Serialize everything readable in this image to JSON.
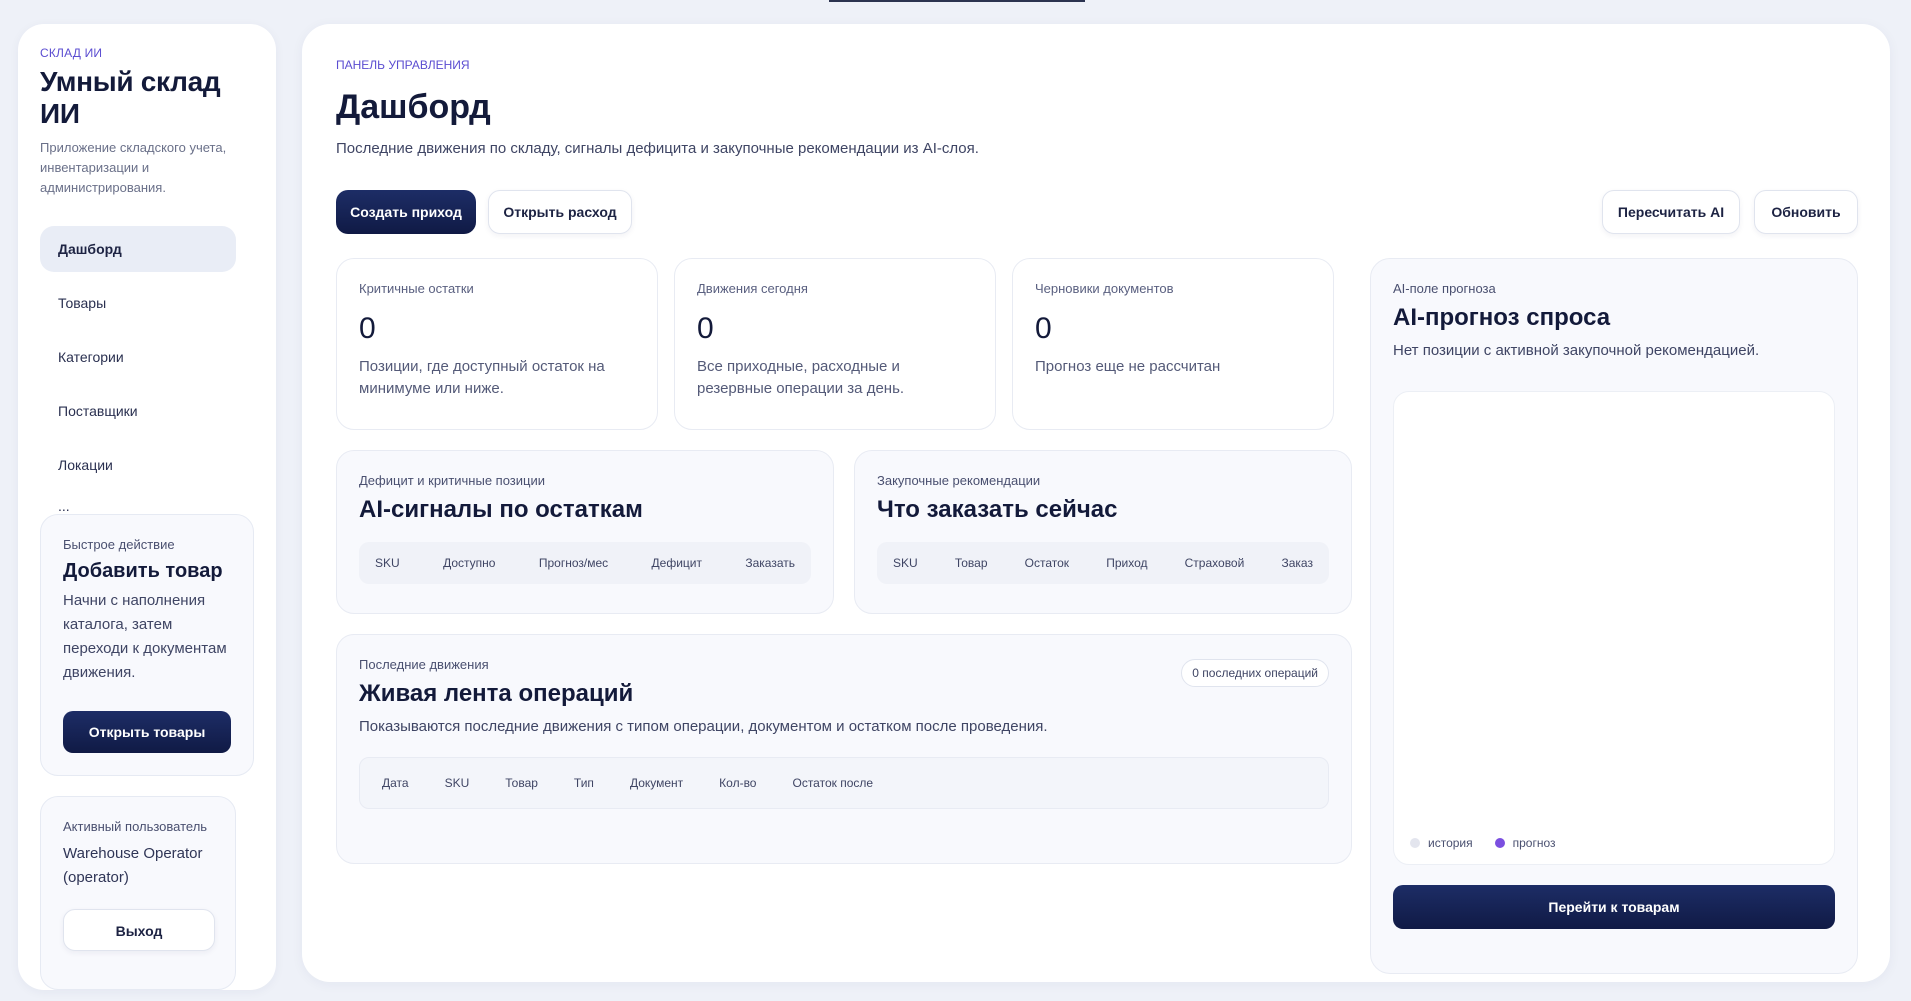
{
  "sidebar": {
    "eyebrow": "СКЛАД ИИ",
    "title": "Умный склад ИИ",
    "description": "Приложение складского учета, инвентаризации и администрирования.",
    "nav": [
      {
        "label": "Дашборд"
      },
      {
        "label": "Товары"
      },
      {
        "label": "Категории"
      },
      {
        "label": "Поставщики"
      },
      {
        "label": "Локации"
      },
      {
        "label": "..."
      }
    ],
    "quick_action": {
      "label": "Быстрое действие",
      "title": "Добавить товар",
      "text": "Начни с наполнения каталога, затем переходи к документам движения.",
      "button": "Открыть товары"
    },
    "user": {
      "label": "Активный пользователь",
      "name": "Warehouse Operator (operator)",
      "logout": "Выход"
    }
  },
  "header": {
    "eyebrow": "ПАНЕЛЬ УПРАВЛЕНИЯ",
    "title": "Дашборд",
    "subtitle": "Последние движения по складу, сигналы дефицита и закупочные рекомендации из AI-слоя."
  },
  "actions": {
    "create_receipt": "Создать приход",
    "open_expense": "Открыть расход",
    "recalc_ai": "Пересчитать AI",
    "refresh": "Обновить"
  },
  "kpis": [
    {
      "label": "Критичные остатки",
      "value": "0",
      "desc": "Позиции, где доступный остаток на минимуме или ниже."
    },
    {
      "label": "Движения сегодня",
      "value": "0",
      "desc": "Все приходные, расходные и резервные операции за день."
    },
    {
      "label": "Черновики документов",
      "value": "0",
      "desc": "Прогноз еще не рассчитан"
    }
  ],
  "signals": {
    "label": "Дефицит и критичные позиции",
    "title": "AI-сигналы по остаткам",
    "columns": [
      "SKU",
      "Доступно",
      "Прогноз/мес",
      "Дефицит",
      "Заказать"
    ]
  },
  "purchase": {
    "label": "Закупочные рекомендации",
    "title": "Что заказать сейчас",
    "columns": [
      "SKU",
      "Товар",
      "Остаток",
      "Приход",
      "Страховой",
      "Заказ"
    ]
  },
  "feed": {
    "label": "Последние движения",
    "title": "Живая лента операций",
    "badge": "0 последних операций",
    "subtitle": "Показываются последние движения с типом операции, документом и остатком после проведения.",
    "columns": [
      "Дата",
      "SKU",
      "Товар",
      "Тип",
      "Документ",
      "Кол-во",
      "Остаток после"
    ]
  },
  "forecast": {
    "label": "AI-поле прогноза",
    "title": "AI-прогноз спроса",
    "subtitle": "Нет позиции с активной закупочной рекомендацией.",
    "legend": [
      {
        "name": "история",
        "color": "#e3e5ee"
      },
      {
        "name": "прогноз",
        "color": "#7b4fe0"
      }
    ],
    "button": "Перейти к товарам"
  }
}
